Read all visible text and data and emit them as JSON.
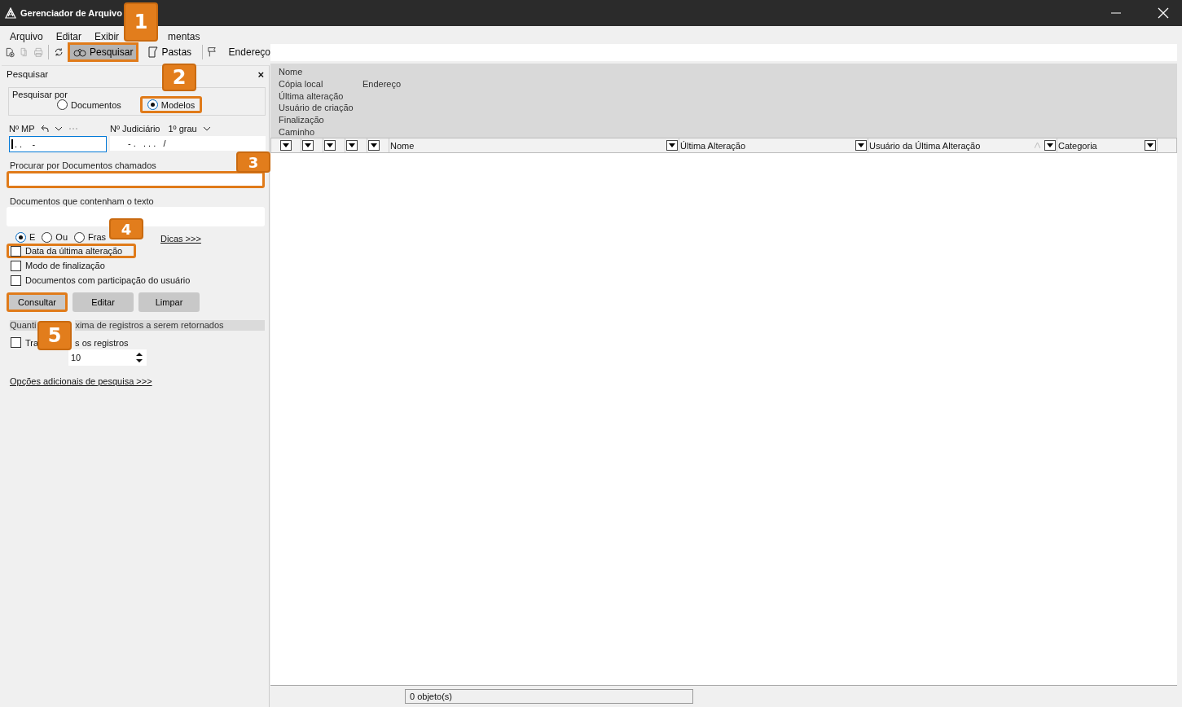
{
  "window": {
    "title": "Gerenciador de Arquivo"
  },
  "menu": [
    {
      "label": "Arquivo"
    },
    {
      "label": "Editar"
    },
    {
      "label": "Exibir"
    },
    {
      "label": "mentas"
    }
  ],
  "toolbar": {
    "tools": [
      {
        "kind": "new",
        "disabled": false
      },
      {
        "kind": "copy",
        "disabled": true
      },
      {
        "kind": "print",
        "disabled": true
      },
      {
        "kind": "refresh",
        "disabled": false
      }
    ],
    "buttons": [
      {
        "kind": "search",
        "label": "Pesquisar",
        "selected": true,
        "highlighted": true
      },
      {
        "kind": "folders",
        "label": "Pastas",
        "selected": false,
        "highlighted": false
      }
    ],
    "address_label": "Endereço"
  },
  "search_panel": {
    "title": "Pesquisar",
    "close": "×",
    "search_by": {
      "label": "Pesquisar por",
      "options": [
        {
          "label": "Documentos",
          "selected": false,
          "highlighted": false
        },
        {
          "label": "Modelos",
          "selected": true,
          "highlighted": true
        }
      ]
    },
    "mp": {
      "label": "Nº MP",
      "value": ". .    -"
    },
    "judicial": {
      "label": "Nº Judiciário",
      "degree": "1º grau",
      "value": "- .   . . .   /"
    },
    "name_field": {
      "label": "Procurar por Documentos chamados",
      "highlighted": true
    },
    "text_field": {
      "label": "Documentos que contenham o texto"
    },
    "logic": [
      {
        "label": "E",
        "selected": true
      },
      {
        "label": "Ou",
        "selected": false
      },
      {
        "label": "Fras",
        "selected": false
      }
    ],
    "tips_link": "Dicas >>>",
    "filters": [
      {
        "label": "Data da última alteração",
        "checked": false,
        "highlighted": true
      },
      {
        "label": "Modo de finalização",
        "checked": false,
        "highlighted": false
      },
      {
        "label": "Documentos com participação do usuário",
        "checked": false,
        "highlighted": false
      }
    ],
    "actions": [
      {
        "label": "Consultar",
        "highlighted": true
      },
      {
        "label": "Editar",
        "highlighted": false
      },
      {
        "label": "Limpar",
        "highlighted": false
      }
    ],
    "max_records": {
      "label_parts": [
        "Quanti",
        "xima de registros a serem retornados"
      ],
      "all_label_parts": [
        "Tra",
        "s os registros"
      ],
      "all_checked": false,
      "value": "10"
    },
    "more_options_link": "Opções adicionais de pesquisa >>>"
  },
  "details": [
    {
      "label": "Nome"
    },
    {
      "label": "Cópia local",
      "extra": "Endereço"
    },
    {
      "label": "Última alteração"
    },
    {
      "label": "Usuário de criação"
    },
    {
      "label": "Finalização"
    },
    {
      "label": "Caminho"
    }
  ],
  "columns": [
    {
      "kind": "blank",
      "sorted": false
    },
    {
      "kind": "blank",
      "sorted": false
    },
    {
      "kind": "blank",
      "sorted": false
    },
    {
      "kind": "blank",
      "sorted": false
    },
    {
      "kind": "blank",
      "sorted": false
    },
    {
      "kind": "named",
      "label": "Nome",
      "sorted": false
    },
    {
      "kind": "named",
      "label": "Última Alteração",
      "sorted": false
    },
    {
      "kind": "named",
      "label": "Usuário da Última Alteração",
      "sorted": true
    },
    {
      "kind": "named",
      "label": "Categoria",
      "sorted": false
    }
  ],
  "status_bar": {
    "text": "0 objeto(s)"
  },
  "callouts": [
    {
      "number": "1"
    },
    {
      "number": "2"
    },
    {
      "number": "3"
    },
    {
      "number": "4"
    },
    {
      "number": "5"
    }
  ]
}
